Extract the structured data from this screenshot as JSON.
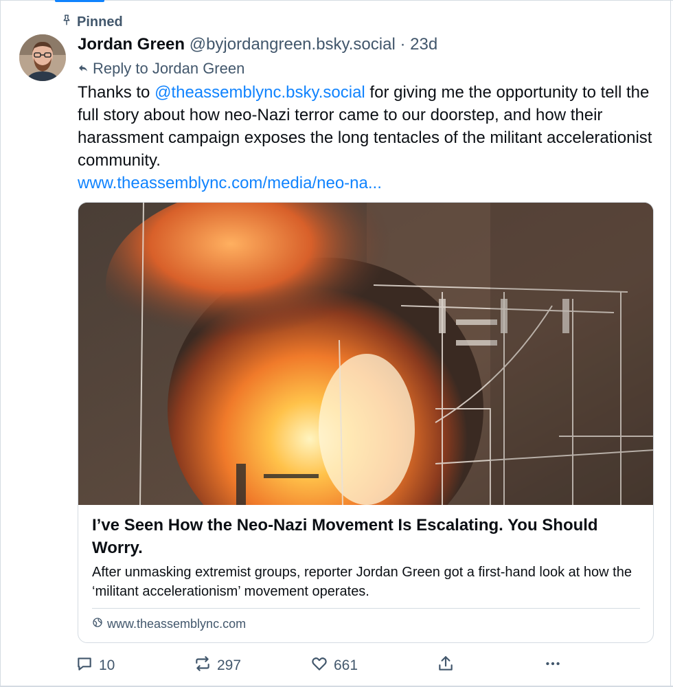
{
  "pinned_label": "Pinned",
  "author": {
    "name": "Jordan Green",
    "handle": "@byjordangreen.bsky.social",
    "separator": "·",
    "age": "23d"
  },
  "reply_to": "Reply to Jordan Green",
  "post": {
    "text_before": "Thanks to ",
    "mention": "@theassemblync.bsky.social",
    "text_after": " for giving me the opportunity to tell the full story about how neo-Nazi terror came to our doorstep, and how their harassment campaign exposes the long tentacles of the militant accelerationist community.",
    "link": "www.theassemblync.com/media/neo-na..."
  },
  "card": {
    "title": "I’ve Seen How the Neo-Nazi Movement Is Escalating. You Should Worry.",
    "description": "After unmasking extremist groups, reporter Jordan Green got a first-hand look at how the ‘militant accelerationism’ movement operates.",
    "domain": "www.theassemblync.com"
  },
  "actions": {
    "replies": "10",
    "reposts": "297",
    "likes": "661"
  },
  "colors": {
    "accent": "#1083fe",
    "muted": "#42576c",
    "border": "#d4dbe2"
  }
}
